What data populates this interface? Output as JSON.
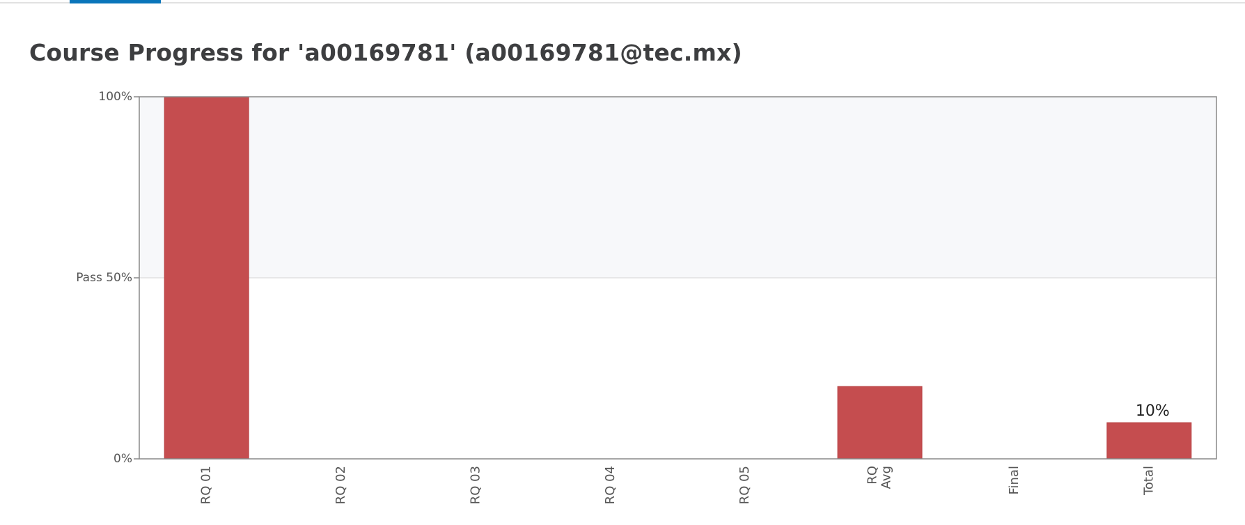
{
  "page": {
    "title": "Course Progress for 'a00169781' (a00169781@tec.mx)"
  },
  "colors": {
    "bar": "#c54d4f",
    "bar_edge": "#b84446",
    "pass_band": "#f7f8fa",
    "gridline": "#dcdcdc",
    "axis": "#888888",
    "tab_indicator": "#0a75ba"
  },
  "chart_data": {
    "type": "bar",
    "title": "",
    "xlabel": "",
    "ylabel": "",
    "ylim": [
      0,
      100
    ],
    "categories": [
      "RQ 01",
      "RQ 02",
      "RQ 03",
      "RQ 04",
      "RQ 05",
      "RQ\nAvg",
      "Final",
      "Total"
    ],
    "values": [
      100,
      0,
      0,
      0,
      0,
      20,
      0,
      10
    ],
    "value_labels": [
      null,
      null,
      null,
      null,
      null,
      null,
      null,
      "10%"
    ],
    "y_ticks": [
      {
        "value": 100,
        "label": "100%"
      },
      {
        "value": 50,
        "label": "Pass 50%"
      },
      {
        "value": 0,
        "label": "0%"
      }
    ],
    "pass_threshold": 50,
    "grid": true
  }
}
